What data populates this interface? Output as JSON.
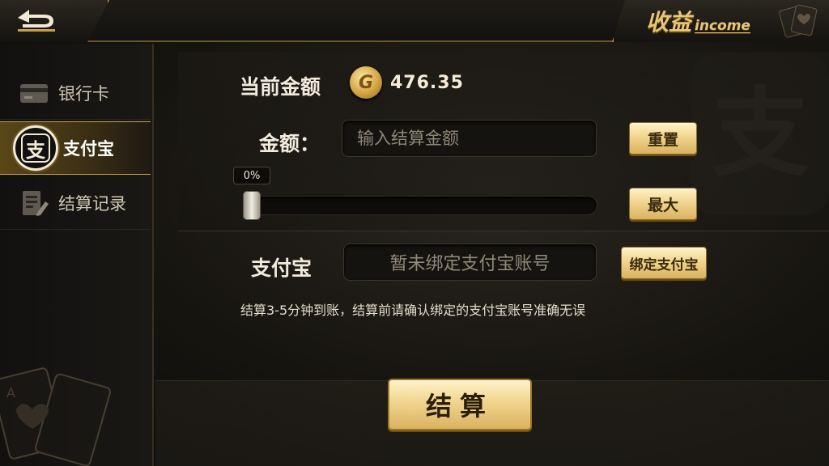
{
  "header": {
    "back_icon": "back-arrow-icon",
    "title_zh": "收益",
    "title_en": "income"
  },
  "sidebar": {
    "items": [
      {
        "label": "银行卡",
        "icon": "bank-card-icon",
        "active": false
      },
      {
        "label": "支付宝",
        "icon": "alipay-icon",
        "icon_glyph": "支",
        "active": true
      },
      {
        "label": "结算记录",
        "icon": "record-edit-icon",
        "active": false
      }
    ]
  },
  "main": {
    "watermark": "支",
    "balance_label": "当前金额",
    "coin_glyph": "G",
    "balance_value": "476.35",
    "amount_label": "金额：",
    "amount_placeholder": "输入结算金额",
    "amount_value": "",
    "reset_label": "重置",
    "slider_percent_label": "0%",
    "slider_value": 0,
    "max_label": "最大",
    "alipay_label": "支付宝",
    "alipay_account_text": "暂未绑定支付宝账号",
    "bind_label": "绑定支付宝",
    "note": "结算3-5分钟到账，结算前请确认绑定的支付宝账号准确无误",
    "settle_label": "结算"
  },
  "colors": {
    "accent_gold": "#e9c677",
    "button_gold": "#f1d58e",
    "background": "#16140f"
  }
}
